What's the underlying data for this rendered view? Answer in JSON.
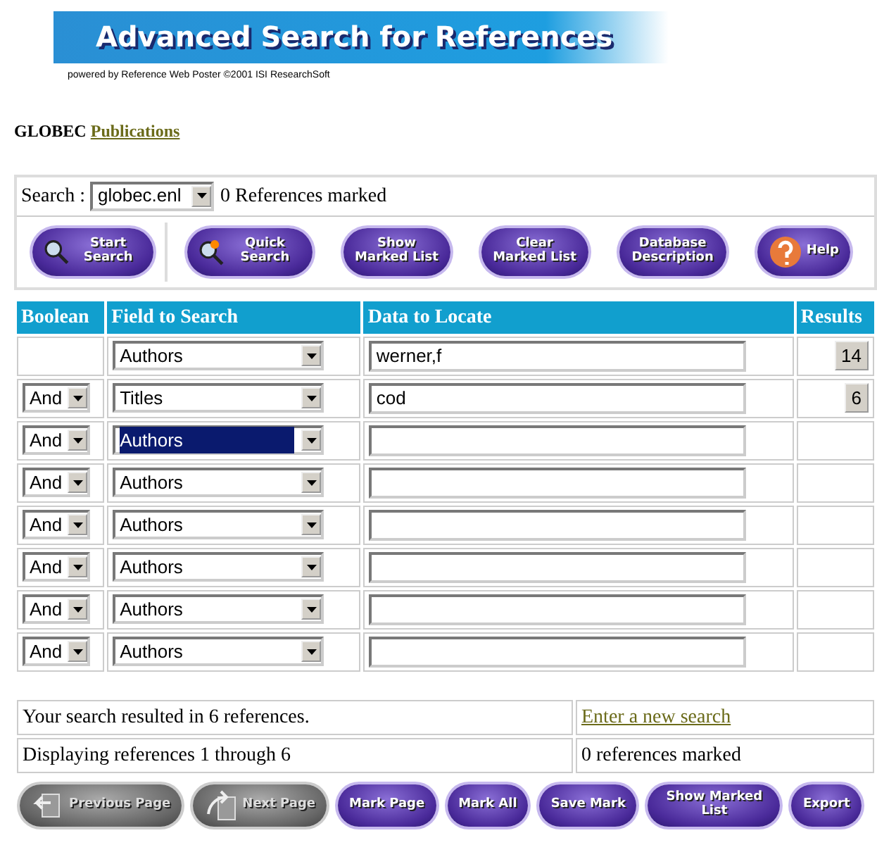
{
  "banner": {
    "title": "Advanced Search for References",
    "credit": "powered by Reference Web Poster ©2001 ISI ResearchSoft"
  },
  "heading": {
    "name": "GLOBEC",
    "link": "Publications"
  },
  "search_bar": {
    "label": "Search :",
    "database": "globec.enl",
    "marked": "0 References marked"
  },
  "toolbar": [
    {
      "label": "Start Search",
      "kind": "search",
      "disabled": false
    },
    {
      "label": "Quick Search",
      "kind": "quick",
      "disabled": false
    },
    {
      "label": "Show Marked List",
      "kind": "plain",
      "disabled": false
    },
    {
      "label": "Clear Marked List",
      "kind": "plain",
      "disabled": false
    },
    {
      "label": "Database Description",
      "kind": "plain",
      "disabled": false
    },
    {
      "label": "Help",
      "kind": "help",
      "disabled": false
    }
  ],
  "query_table": {
    "columns": [
      "Boolean",
      "Field to Search",
      "Data to Locate",
      "Results"
    ],
    "rows": [
      {
        "field": "Authors",
        "field_highlighted": false,
        "value": "werner,f",
        "results": "14"
      },
      {
        "boolean": "And",
        "field": "Titles",
        "field_highlighted": false,
        "value": "cod",
        "results": "6"
      },
      {
        "boolean": "And",
        "field": "Authors",
        "field_highlighted": true
      },
      {
        "boolean": "And",
        "field": "Authors",
        "field_highlighted": false
      },
      {
        "boolean": "And",
        "field": "Authors",
        "field_highlighted": false
      },
      {
        "boolean": "And",
        "field": "Authors",
        "field_highlighted": false
      },
      {
        "boolean": "And",
        "field": "Authors",
        "field_highlighted": false
      },
      {
        "boolean": "And",
        "field": "Authors",
        "field_highlighted": false
      }
    ]
  },
  "summary": {
    "result_text": "Your search resulted in 6 references.",
    "new_search_link": "Enter a new search",
    "displaying": "Displaying references 1 through 6",
    "marked": "0 references marked"
  },
  "bottom_toolbar": [
    {
      "label": "Previous Page",
      "kind": "back",
      "disabled": true
    },
    {
      "label": "Next Page",
      "kind": "forward",
      "disabled": true
    },
    {
      "label": "Mark Page",
      "kind": "plain",
      "disabled": false
    },
    {
      "label": "Mark All",
      "kind": "plain",
      "disabled": false
    },
    {
      "label": "Save Mark",
      "kind": "plain",
      "disabled": false
    },
    {
      "label": "Show Marked List",
      "kind": "plain",
      "disabled": false
    },
    {
      "label": "Export",
      "kind": "plain",
      "disabled": false
    }
  ]
}
